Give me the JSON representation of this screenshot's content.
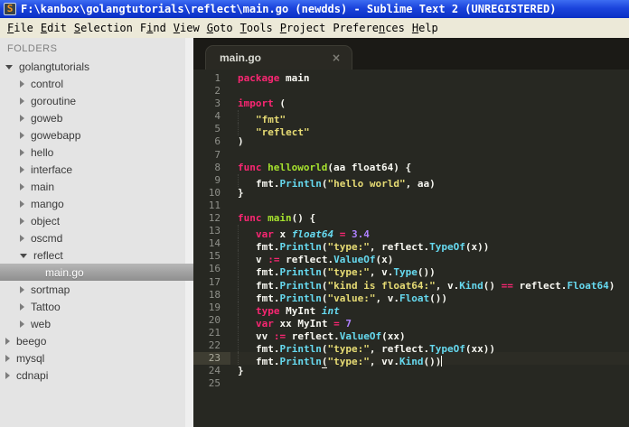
{
  "window": {
    "title": "F:\\kanbox\\golangtutorials\\reflect\\main.go (newdds) - Sublime Text 2 (UNREGISTERED)",
    "icon_glyph": "S"
  },
  "menu": {
    "items": [
      {
        "label": "File",
        "u": 0
      },
      {
        "label": "Edit",
        "u": 0
      },
      {
        "label": "Selection",
        "u": 0
      },
      {
        "label": "Find",
        "u": 1
      },
      {
        "label": "View",
        "u": 0
      },
      {
        "label": "Goto",
        "u": 0
      },
      {
        "label": "Tools",
        "u": 0
      },
      {
        "label": "Project",
        "u": 0
      },
      {
        "label": "Preferences",
        "u": 7
      },
      {
        "label": "Help",
        "u": 0
      }
    ]
  },
  "sidebar": {
    "header": "FOLDERS",
    "items": [
      {
        "label": "golangtutorials",
        "level": 0,
        "state": "expanded",
        "selected": false
      },
      {
        "label": "control",
        "level": 1,
        "state": "collapsed",
        "selected": false
      },
      {
        "label": "goroutine",
        "level": 1,
        "state": "collapsed",
        "selected": false
      },
      {
        "label": "goweb",
        "level": 1,
        "state": "collapsed",
        "selected": false
      },
      {
        "label": "gowebapp",
        "level": 1,
        "state": "collapsed",
        "selected": false
      },
      {
        "label": "hello",
        "level": 1,
        "state": "collapsed",
        "selected": false
      },
      {
        "label": "interface",
        "level": 1,
        "state": "collapsed",
        "selected": false
      },
      {
        "label": "main",
        "level": 1,
        "state": "collapsed",
        "selected": false
      },
      {
        "label": "mango",
        "level": 1,
        "state": "collapsed",
        "selected": false
      },
      {
        "label": "object",
        "level": 1,
        "state": "collapsed",
        "selected": false
      },
      {
        "label": "oscmd",
        "level": 1,
        "state": "collapsed",
        "selected": false
      },
      {
        "label": "reflect",
        "level": 1,
        "state": "expanded",
        "selected": false
      },
      {
        "label": "main.go",
        "level": 2,
        "state": "file",
        "selected": true
      },
      {
        "label": "sortmap",
        "level": 1,
        "state": "collapsed",
        "selected": false
      },
      {
        "label": "Tattoo",
        "level": 1,
        "state": "collapsed",
        "selected": false
      },
      {
        "label": "web",
        "level": 1,
        "state": "collapsed",
        "selected": false
      },
      {
        "label": "beego",
        "level": 0,
        "state": "collapsed",
        "selected": false
      },
      {
        "label": "mysql",
        "level": 0,
        "state": "collapsed",
        "selected": false
      },
      {
        "label": "cdnapi",
        "level": 0,
        "state": "collapsed",
        "selected": false
      }
    ]
  },
  "tab": {
    "label": "main.go",
    "close_glyph": "×",
    "active": true
  },
  "editor": {
    "language": "go",
    "lines": [
      {
        "num": 1,
        "indent": 0,
        "tokens": [
          [
            "k",
            "package"
          ],
          [
            "p",
            " main"
          ]
        ]
      },
      {
        "num": 2,
        "indent": 0,
        "tokens": []
      },
      {
        "num": 3,
        "indent": 0,
        "tokens": [
          [
            "k",
            "import"
          ],
          [
            "p",
            " ("
          ]
        ]
      },
      {
        "num": 4,
        "indent": 1,
        "tokens": [
          [
            "s",
            "\"fmt\""
          ]
        ]
      },
      {
        "num": 5,
        "indent": 1,
        "tokens": [
          [
            "s",
            "\"reflect\""
          ]
        ]
      },
      {
        "num": 6,
        "indent": 0,
        "tokens": [
          [
            "p",
            ")"
          ]
        ]
      },
      {
        "num": 7,
        "indent": 0,
        "tokens": []
      },
      {
        "num": 8,
        "indent": 0,
        "tokens": [
          [
            "k",
            "func"
          ],
          [
            "p",
            " "
          ],
          [
            "f",
            "helloworld"
          ],
          [
            "p",
            "(aa float64) {"
          ]
        ]
      },
      {
        "num": 9,
        "indent": 1,
        "tokens": [
          [
            "p",
            "fmt."
          ],
          [
            "c",
            "Println"
          ],
          [
            "p",
            "("
          ],
          [
            "s",
            "\"hello world\""
          ],
          [
            "p",
            ", aa)"
          ]
        ]
      },
      {
        "num": 10,
        "indent": 0,
        "tokens": [
          [
            "p",
            "}"
          ]
        ]
      },
      {
        "num": 11,
        "indent": 0,
        "tokens": []
      },
      {
        "num": 12,
        "indent": 0,
        "tokens": [
          [
            "k",
            "func"
          ],
          [
            "p",
            " "
          ],
          [
            "f",
            "main"
          ],
          [
            "p",
            "() {"
          ]
        ]
      },
      {
        "num": 13,
        "indent": 1,
        "tokens": [
          [
            "k",
            "var"
          ],
          [
            "p",
            " x "
          ],
          [
            "t",
            "float64"
          ],
          [
            "p",
            " "
          ],
          [
            "k",
            "="
          ],
          [
            "p",
            " "
          ],
          [
            "n",
            "3.4"
          ]
        ]
      },
      {
        "num": 14,
        "indent": 1,
        "tokens": [
          [
            "p",
            "fmt."
          ],
          [
            "c",
            "Println"
          ],
          [
            "p",
            "("
          ],
          [
            "s",
            "\"type:\""
          ],
          [
            "p",
            ", reflect."
          ],
          [
            "c",
            "TypeOf"
          ],
          [
            "p",
            "(x))"
          ]
        ]
      },
      {
        "num": 15,
        "indent": 1,
        "tokens": [
          [
            "p",
            "v "
          ],
          [
            "k",
            ":="
          ],
          [
            "p",
            " reflect."
          ],
          [
            "c",
            "ValueOf"
          ],
          [
            "p",
            "(x)"
          ]
        ]
      },
      {
        "num": 16,
        "indent": 1,
        "tokens": [
          [
            "p",
            "fmt."
          ],
          [
            "c",
            "Println"
          ],
          [
            "p",
            "("
          ],
          [
            "s",
            "\"type:\""
          ],
          [
            "p",
            ", v."
          ],
          [
            "c",
            "Type"
          ],
          [
            "p",
            "())"
          ]
        ]
      },
      {
        "num": 17,
        "indent": 1,
        "tokens": [
          [
            "p",
            "fmt."
          ],
          [
            "c",
            "Println"
          ],
          [
            "p",
            "("
          ],
          [
            "s",
            "\"kind is float64:\""
          ],
          [
            "p",
            ", v."
          ],
          [
            "c",
            "Kind"
          ],
          [
            "p",
            "() "
          ],
          [
            "k",
            "=="
          ],
          [
            "p",
            " reflect."
          ],
          [
            "c",
            "Float64"
          ],
          [
            "p",
            ")"
          ]
        ]
      },
      {
        "num": 18,
        "indent": 1,
        "tokens": [
          [
            "p",
            "fmt."
          ],
          [
            "c",
            "Println"
          ],
          [
            "p",
            "("
          ],
          [
            "s",
            "\"value:\""
          ],
          [
            "p",
            ", v."
          ],
          [
            "c",
            "Float"
          ],
          [
            "p",
            "())"
          ]
        ]
      },
      {
        "num": 19,
        "indent": 1,
        "tokens": [
          [
            "k",
            "type"
          ],
          [
            "p",
            " MyInt "
          ],
          [
            "t",
            "int"
          ]
        ]
      },
      {
        "num": 20,
        "indent": 1,
        "tokens": [
          [
            "k",
            "var"
          ],
          [
            "p",
            " xx MyInt "
          ],
          [
            "k",
            "="
          ],
          [
            "p",
            " "
          ],
          [
            "n",
            "7"
          ]
        ]
      },
      {
        "num": 21,
        "indent": 1,
        "tokens": [
          [
            "p",
            "vv "
          ],
          [
            "k",
            ":="
          ],
          [
            "p",
            " reflect."
          ],
          [
            "c",
            "ValueOf"
          ],
          [
            "p",
            "(xx)"
          ]
        ]
      },
      {
        "num": 22,
        "indent": 1,
        "tokens": [
          [
            "p",
            "fmt."
          ],
          [
            "c",
            "Println"
          ],
          [
            "p",
            "("
          ],
          [
            "s",
            "\"type:\""
          ],
          [
            "p",
            ", reflect."
          ],
          [
            "c",
            "TypeOf"
          ],
          [
            "p",
            "(xx))"
          ]
        ]
      },
      {
        "num": 23,
        "indent": 1,
        "current": true,
        "cursor": true,
        "tokens": [
          [
            "p",
            "fmt."
          ],
          [
            "c",
            "Println"
          ],
          [
            "b",
            "("
          ],
          [
            "s",
            "\"type:\""
          ],
          [
            "p",
            ", vv."
          ],
          [
            "c",
            "Kind"
          ],
          [
            "p",
            "())"
          ]
        ]
      },
      {
        "num": 24,
        "indent": 0,
        "tokens": [
          [
            "p",
            "}"
          ]
        ]
      },
      {
        "num": 25,
        "indent": 0,
        "tokens": []
      }
    ]
  },
  "colors": {
    "titlebar_blue": "#1B44DC",
    "menubar_bg": "#ECE9D8",
    "sidebar_bg": "#E4E4E4",
    "editor_bg": "#272822",
    "keyword": "#F92672",
    "function_name": "#A6E22E",
    "builtin_call": "#66D9EF",
    "type_italic": "#66D9EF",
    "string": "#E6DB74",
    "number": "#AE81FF",
    "foreground": "#F8F8F2",
    "line_number": "#8F908A",
    "current_line_gutter": "#3E3D32"
  }
}
